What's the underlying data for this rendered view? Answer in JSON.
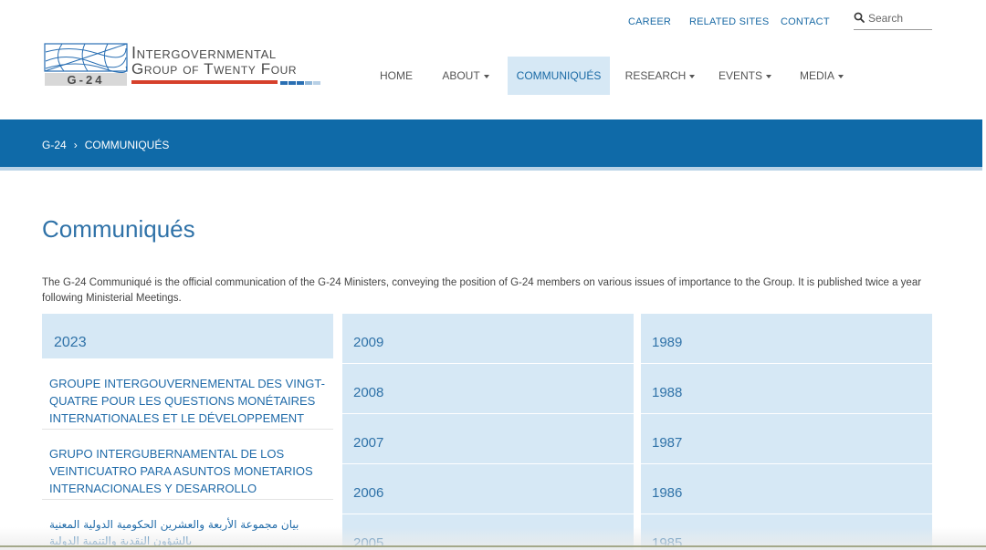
{
  "utility_nav": {
    "career": "CAREER",
    "related_sites": "RELATED SITES",
    "contact": "CONTACT",
    "search_placeholder": "Search"
  },
  "logo": {
    "line1": "Intergovernmental",
    "line2": "Group of Twenty Four",
    "mark_text": "G-24"
  },
  "nav": {
    "home": "HOME",
    "about": "ABOUT",
    "communiques": "COMMUNIQUÉS",
    "research": "RESEARCH",
    "events": "EVENTS",
    "media": "MEDIA",
    "active": "communiques"
  },
  "breadcrumb": {
    "root": "G-24",
    "current": "COMMUNIQUÉS"
  },
  "page": {
    "title": "Communiqués",
    "intro": "The G-24 Communiqué is the official communication of the G-24 Ministers, conveying the position of G-24 members on various issues of importance to the Group. It is published twice a year following Ministerial Meetings."
  },
  "columns": {
    "col1": {
      "year": "2023",
      "documents": [
        "Groupe Intergouvernemental des Vingt-Quatre pour les Questions Monétaires Internationales et le Développement",
        "Grupo Intergubernamental de los Veinticuatro para Asuntos Monetarios Internacionales y Desarrollo",
        "بيان مجموعة الأربعة والعشرين الحكومية الدولية المعنية بالشؤون النقدية والتنمية الدولية"
      ]
    },
    "col2": {
      "years": [
        "2009",
        "2008",
        "2007",
        "2006",
        "2005"
      ]
    },
    "col3": {
      "years": [
        "1989",
        "1988",
        "1987",
        "1986",
        "1985"
      ]
    }
  },
  "colors": {
    "brand_blue": "#0f6aa8",
    "light_blue": "#d6e8f5",
    "link_blue": "#1f6aa8",
    "logo_red": "#d6402b"
  }
}
